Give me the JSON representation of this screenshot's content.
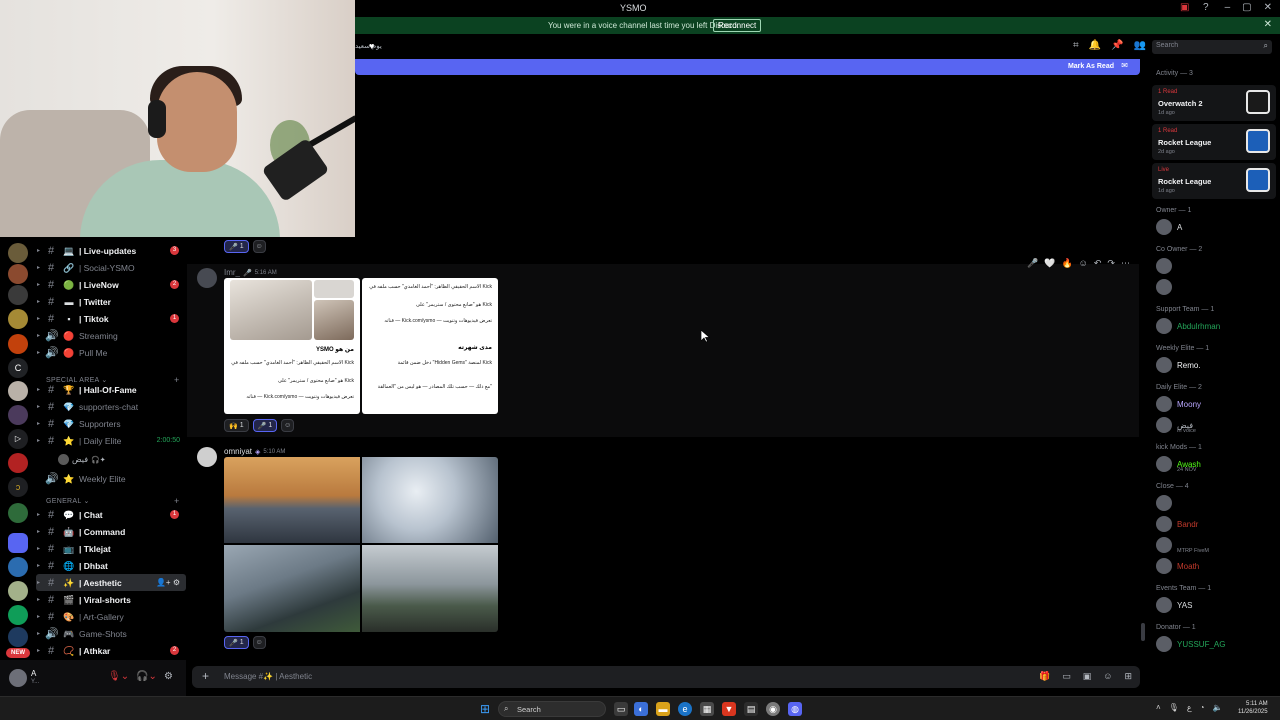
{
  "window": {
    "title": "YSMO"
  },
  "notice": {
    "text": "You were in a voice channel last time you left Discord.",
    "button": "Reconnect"
  },
  "chatbar": {
    "left_text": "يوم سعيد",
    "search_placeholder": "Search"
  },
  "banner": {
    "label": "Mark As Read"
  },
  "channels": [
    {
      "label": "| Live-updates",
      "bright": true,
      "icon": "💻",
      "badge": "3"
    },
    {
      "label": "| Social-YSMO",
      "bright": false,
      "icon": "🔗"
    },
    {
      "label": "| LiveNow",
      "bright": true,
      "icon": "🟢",
      "badge": "2"
    },
    {
      "label": "| Twitter",
      "bright": true,
      "icon": "▬"
    },
    {
      "label": "| Tiktok",
      "bright": true,
      "icon": "▪",
      "badge": "1"
    },
    {
      "label": "Streaming",
      "bright": false,
      "icon": "🔴"
    },
    {
      "label": "Pull Me",
      "bright": false,
      "icon": "🔴"
    }
  ],
  "category_special": "SPECIAL AREA",
  "special_channels": [
    {
      "label": "| Hall-Of-Fame",
      "bright": true,
      "icon": "🏆"
    },
    {
      "label": "supporters-chat",
      "bright": false,
      "icon": "💎"
    },
    {
      "label": "Supporters",
      "bright": false,
      "icon": "💎"
    },
    {
      "label": "| Daily Elite",
      "bright": false,
      "icon": "⭐",
      "timer": "2:00:50"
    }
  ],
  "voice_user": {
    "name": "فيض"
  },
  "weekly_elite": "Weekly Elite",
  "category_general": "GENERAL",
  "general_channels": [
    {
      "label": "| Chat",
      "bright": true,
      "icon": "💬",
      "badge": "1"
    },
    {
      "label": "| Command",
      "bright": true,
      "icon": "🤖"
    },
    {
      "label": "| Tklejat",
      "bright": true,
      "icon": "📺"
    },
    {
      "label": "| Dhbat",
      "bright": true,
      "icon": "🌐"
    },
    {
      "label": "| Aesthetic",
      "bright": true,
      "icon": "✨",
      "active": true
    },
    {
      "label": "| Viral-shorts",
      "bright": true,
      "icon": "🎬"
    },
    {
      "label": "| Art-Gallery",
      "bright": false,
      "icon": "🎨"
    },
    {
      "label": "Game-Shots",
      "bright": false,
      "icon": "🎮"
    },
    {
      "label": "| Athkar",
      "bright": true,
      "icon": "📿",
      "badge": "2"
    }
  ],
  "user_panel": {
    "name": "A",
    "status": "Y..."
  },
  "reactions_top": [
    {
      "emoji": "🎤",
      "count": "1"
    }
  ],
  "message1": {
    "author": "Imr_",
    "time": "5:16 AM",
    "pane_left": {
      "title": "YSMO من هو",
      "lines": [
        "الاسم الحقيقي الظاهر: \"أحمد الغامدي\" حسب ملفه في Kick",
        "هو \"صانع محتوى / ستريمر\" على Kick",
        "قناته — Kick.com/ysmo — تعرض فيديوهات وتنويت"
      ]
    },
    "pane_right": {
      "title": "مدى شهرته",
      "lines": [
        "الاسم الحقيقي الظاهر: \"أحمد الغامدي\" حسب ملفه في Kick",
        "هو \"صانع محتوى / ستريمر\" على Kick",
        "قناته — Kick.com/ysmo — تعرض فيديوهات وتنويت",
        "دخل ضمن قائمة \"Hidden Gems\" لمنصة Kick",
        "مع ذلك — حسب تلك المصادر — هو ليس من \"العمالقة\""
      ]
    },
    "reactions": [
      {
        "emoji": "🙌",
        "count": "1"
      },
      {
        "emoji": "🎤",
        "count": "1"
      }
    ]
  },
  "message2": {
    "author": "omniyat",
    "time": "5:10 AM",
    "reactions": [
      {
        "emoji": "🎤",
        "count": "1"
      }
    ]
  },
  "composer": {
    "placeholder": "Message #✨ | Aesthetic"
  },
  "members": {
    "activity_head": "Activity — 3",
    "activities": [
      {
        "status": "1 Read",
        "game": "Overwatch 2",
        "ago": "1d ago",
        "color": "#1a1a1a"
      },
      {
        "status": "1 Read",
        "game": "Rocket League",
        "ago": "2d ago",
        "color": "#1c5fb8"
      },
      {
        "status": "Live",
        "game": "Rocket League",
        "ago": "1d ago",
        "color": "#1c5fb8"
      }
    ],
    "groups": [
      {
        "head": "Owner — 1",
        "items": [
          {
            "name": "A",
            "color": "#dbdee1"
          }
        ]
      },
      {
        "head": "Co Owner — 2",
        "items": [
          {
            "name": "",
            "color": "#da373c"
          },
          {
            "name": "",
            "color": "#9b59b6"
          }
        ]
      },
      {
        "head": "Support Team — 1",
        "items": [
          {
            "name": "Abdulrhman",
            "color": "#23a559"
          }
        ]
      },
      {
        "head": "Weekly Elite — 1",
        "items": [
          {
            "name": "Remo.",
            "color": "#f2f3f5"
          }
        ]
      },
      {
        "head": "Daily Elite — 2",
        "items": [
          {
            "name": "Moony",
            "color": "#b9a7ff"
          },
          {
            "name": "فيض",
            "color": "#b5bac1",
            "sub": "In voice"
          }
        ]
      },
      {
        "head": "kick Mods — 1",
        "items": [
          {
            "name": "Awash",
            "color": "#53fc18",
            "sub": "24 NOV"
          }
        ]
      },
      {
        "head": "Close — 4",
        "items": [
          {
            "name": "",
            "color": "#da373c"
          },
          {
            "name": "Bandr",
            "color": "#c0392b"
          },
          {
            "name": "",
            "color": "#c0392b",
            "sub": "MTRP FiveM"
          },
          {
            "name": "Moath",
            "color": "#c0392b"
          }
        ]
      },
      {
        "head": "Events Team — 1",
        "items": [
          {
            "name": "YAS",
            "color": "#dbdee1"
          }
        ]
      },
      {
        "head": "Donator — 1",
        "items": [
          {
            "name": "YUSSUF_AG",
            "color": "#23a559"
          }
        ]
      }
    ]
  },
  "taskbar": {
    "search": "Search",
    "time": "5:11 AM",
    "date": "11/26/2025"
  }
}
